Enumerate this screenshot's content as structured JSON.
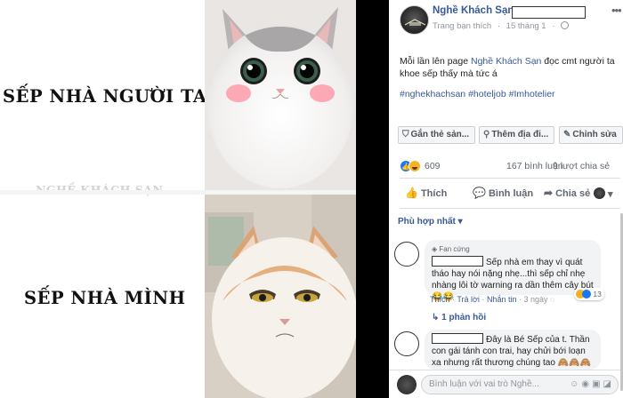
{
  "photo": {
    "caption_top": "SẾP NHÀ NGƯỜI TA",
    "caption_bottom": "SẾP NHÀ MÌNH",
    "watermark": "NGHỀ KHÁCH SẠN"
  },
  "post": {
    "page_name": "Nghề Khách Sạn",
    "more_icon": "ellipsis-icon",
    "subline_prefix": "Trang bạn thích",
    "date": "15 tháng 1",
    "body_prefix": "Mỗi lần lên page ",
    "body_link": "Nghề Khách Sạn",
    "body_suffix": " đọc cmt người ta khoe sếp thấy mà tức á",
    "hashtags": "#nghekhachsan #hoteljob #Imhotelier",
    "chips": [
      {
        "icon": "tag-icon",
        "label": "Gắn thẻ sản..."
      },
      {
        "icon": "location-pin-icon",
        "label": "Thêm địa đi..."
      },
      {
        "icon": "pencil-icon",
        "label": "Chỉnh sửa"
      }
    ],
    "reaction_count": "609",
    "comment_count": "167 bình luận",
    "share_count": "9 lượt chia sẻ",
    "actions": {
      "like": "Thích",
      "comment": "Bình luận",
      "share": "Chia sẻ"
    },
    "sort_label": "Phù hợp nhất",
    "comments": [
      {
        "badge": "Fan cứng",
        "text": "Sếp nhà em thay vì quát tháo hay nói nặng nhẹ...thì sếp chỉ nhẹ nhàng lôi tờ warning ra dần thêm cây bút 😂😂",
        "like": "Thích",
        "reply": "Trả lời",
        "message": "Nhắn tin",
        "time": "3 ngày",
        "reactions": "13",
        "replies": "1 phản hồi"
      },
      {
        "text": "Đây là Bé Sếp của t. Thần con gái tánh con trai, hay chửi bới loạn xa nhưng rất thương chúng tao 🙈🙈🙈🙈"
      }
    ],
    "composer_placeholder": "Bình luận với vai trò Nghề..."
  },
  "colors": {
    "link": "#385898",
    "meta": "#90949c",
    "bubble": "#f2f3f5"
  }
}
